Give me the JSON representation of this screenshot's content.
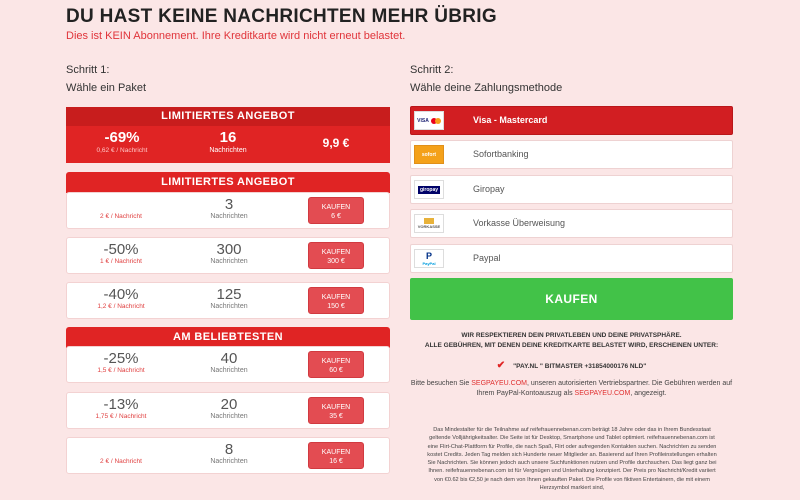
{
  "header": {
    "title": "DU HAST KEINE NACHRICHTEN MEHR ÜBRIG",
    "subtitle": "Dies ist KEIN Abonnement. Ihre Kreditkarte wird nicht erneut belastet."
  },
  "step1": {
    "title": "Schritt 1:",
    "subtitle": "Wähle ein Paket"
  },
  "step2": {
    "title": "Schritt 2:",
    "subtitle": "Wähle deine Zahlungsmethode"
  },
  "hero": {
    "banner": "LIMITIERTES ANGEBOT",
    "discount": "-69%",
    "per_message": "0,62 € / Nachricht",
    "count": "16",
    "count_label": "Nachrichten",
    "price": "9,9 €"
  },
  "sections": {
    "limited": "LIMITIERTES ANGEBOT",
    "popular": "AM BELIEBTESTEN"
  },
  "packages": [
    {
      "discount": "",
      "per_message": "2 € / Nachricht",
      "count": "3",
      "count_label": "Nachrichten",
      "buy_label": "KAUFEN",
      "price": "6 €"
    },
    {
      "discount": "-50%",
      "per_message": "1 € / Nachricht",
      "count": "300",
      "count_label": "Nachrichten",
      "buy_label": "KAUFEN",
      "price": "300 €"
    },
    {
      "discount": "-40%",
      "per_message": "1,2 € / Nachricht",
      "count": "125",
      "count_label": "Nachrichten",
      "buy_label": "KAUFEN",
      "price": "150 €"
    },
    {
      "discount": "-25%",
      "per_message": "1,5 € / Nachricht",
      "count": "40",
      "count_label": "Nachrichten",
      "buy_label": "KAUFEN",
      "price": "60 €"
    },
    {
      "discount": "-13%",
      "per_message": "1,75 € / Nachricht",
      "count": "20",
      "count_label": "Nachrichten",
      "buy_label": "KAUFEN",
      "price": "35 €"
    },
    {
      "discount": "",
      "per_message": "2 € / Nachricht",
      "count": "8",
      "count_label": "Nachrichten",
      "buy_label": "KAUFEN",
      "price": "16 €"
    }
  ],
  "payment_methods": [
    {
      "label": "Visa - Mastercard",
      "icon": "visa-mastercard-icon",
      "logo_text": "VISA",
      "selected": true
    },
    {
      "label": "Sofortbanking",
      "icon": "sofort-icon",
      "logo_text": "sofort",
      "selected": false
    },
    {
      "label": "Giropay",
      "icon": "giropay-icon",
      "logo_text": "giropay",
      "selected": false
    },
    {
      "label": "Vorkasse Überweisung",
      "icon": "vorkasse-icon",
      "logo_text": "VORKASSE",
      "selected": false
    },
    {
      "label": "Paypal",
      "icon": "paypal-icon",
      "logo_text": "PayPal",
      "selected": false
    }
  ],
  "buy_button": "KAUFEN",
  "privacy": {
    "line1": "WIR RESPEKTIEREN DEIN PRIVATLEBEN UND DEINE PRIVATSPHÄRE.",
    "line2": "ALLE GEBÜHREN, MIT DENEN DEINE KREDITKARTE BELASTET WIRD, ERSCHEINEN UNTER:"
  },
  "descriptor": "\"PAY.NL \" BITMASTER +31854000176 NLD\"",
  "visit": {
    "before": "Bitte besuchen Sie ",
    "link1": "SEGPAYEU.COM",
    "middle": ", unseren autorisierten Vertriebspartner. Die Gebühren werden auf Ihrem PayPal-Kontoauszug als ",
    "link2": "SEGPAYEU.COM",
    "after": ", angezeigt."
  },
  "legal": "Das Mindestalter für die Teilnahme auf reifefrauennebenan.com beträgt 18 Jahre oder das in Ihrem Bundesstaat geltende Volljährigkeitsalter. Die Seite ist für Desktop, Smartphone und Tablet optimiert. reifefrauennebenan.com ist eine Flirt-Chat-Plattform für Profile, die nach Spaß, Flirt oder aufregenden Kontakten suchen. Nachrichten zu senden kostet Credits. Jeden Tag melden sich Hunderte neuer Mitglieder an. Basierend auf Ihren Profileinstellungen erhalten Sie Nachrichten. Sie können jedoch auch unsere Suchfunktionen nutzen und Profile durchsuchen. Das liegt ganz bei Ihnen. reifefrauennebenan.com ist für Vergnügen und Unterhaltung konzipiert. Der Preis pro Nachricht/Kredit variiert von €0.62 bis €2,50 je nach dem von Ihnen gekauften Paket. Die Profile von fiktiven Entertainern, die mit einem Herzsymbol markiert sind,",
  "colors": {
    "accent": "#e02424",
    "buy_green": "#42c248",
    "background": "#fbe6e6"
  }
}
